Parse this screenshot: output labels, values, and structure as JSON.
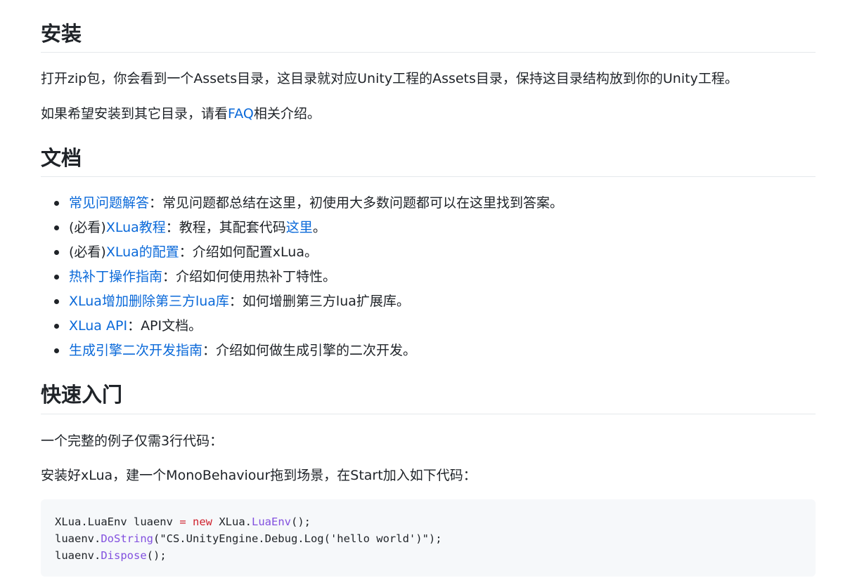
{
  "install": {
    "heading": "安装",
    "para1": "打开zip包，你会看到一个Assets目录，这目录就对应Unity工程的Assets目录，保持这目录结构放到你的Unity工程。",
    "para2_prefix": "如果希望安装到其它目录，请看",
    "para2_link": "FAQ",
    "para2_suffix": "相关介绍。"
  },
  "docs": {
    "heading": "文档",
    "items": [
      {
        "prefix": "",
        "link": "常见问题解答",
        "text": "：常见问题都总结在这里，初使用大多数问题都可以在这里找到答案。",
        "link2": "",
        "suffix": ""
      },
      {
        "prefix": "(必看)",
        "link": "XLua教程",
        "text": "：教程，其配套代码",
        "link2": "这里",
        "suffix": "。"
      },
      {
        "prefix": "(必看)",
        "link": "XLua的配置",
        "text": "：介绍如何配置xLua。",
        "link2": "",
        "suffix": ""
      },
      {
        "prefix": "",
        "link": "热补丁操作指南",
        "text": "：介绍如何使用热补丁特性。",
        "link2": "",
        "suffix": ""
      },
      {
        "prefix": "",
        "link": "XLua增加删除第三方lua库",
        "text": "：如何增删第三方lua扩展库。",
        "link2": "",
        "suffix": ""
      },
      {
        "prefix": "",
        "link": "XLua API",
        "text": "：API文档。",
        "link2": "",
        "suffix": ""
      },
      {
        "prefix": "",
        "link": "生成引擎二次开发指南",
        "text": "：介绍如何做生成引擎的二次开发。",
        "link2": "",
        "suffix": ""
      }
    ]
  },
  "quick": {
    "heading": "快速入门",
    "para1": "一个完整的例子仅需3行代码：",
    "para2": "安装好xLua，建一个MonoBehaviour拖到场景，在Start加入如下代码："
  },
  "code": {
    "line1": {
      "a": "XLua.LuaEnv luaenv ",
      "op": "=",
      "b": " ",
      "kw": "new",
      "c": " XLua.",
      "fn": "LuaEnv",
      "d": "();"
    },
    "line2": {
      "a": "luaenv.",
      "fn": "DoString",
      "b": "(\"CS.UnityEngine.Debug.Log('hello world')\");"
    },
    "line3": {
      "a": "luaenv.",
      "fn": "Dispose",
      "b": "();"
    }
  },
  "colors": {
    "link": "#0a69d9",
    "text": "#1f2328",
    "code_bg": "#f6f8fa",
    "keyword": "#cf222e",
    "function": "#8250df"
  }
}
